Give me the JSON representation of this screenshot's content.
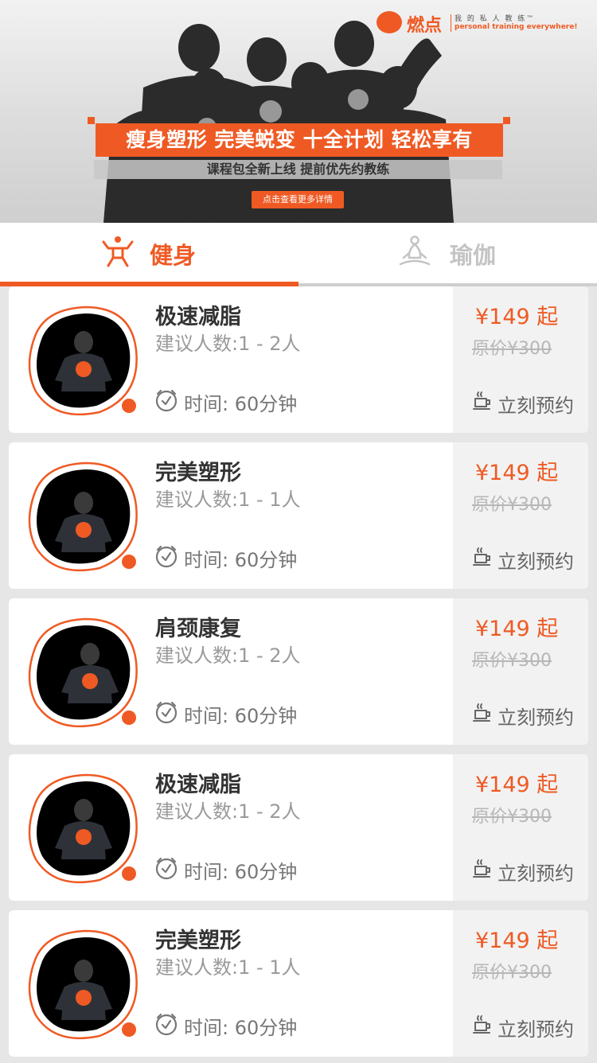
{
  "banner": {
    "brand_name": "燃点",
    "brand_tagline_cn": "我 的 私 人 教 练™",
    "brand_tagline_en": "personal training everywhere!",
    "slogan": "瘦身塑形  完美蜕变  十全计划  轻松享有",
    "sub_slogan": "课程包全新上线   提前优先约教练",
    "detail_button": "点击查看更多详情"
  },
  "tabs": [
    {
      "label": "健身",
      "icon": "fitness-person-icon",
      "active": true
    },
    {
      "label": "瑜伽",
      "icon": "yoga-meditation-icon",
      "active": false
    }
  ],
  "colors": {
    "accent": "#ef5a24",
    "inactive": "#c4c4c4",
    "price_panel": "#f2f2f2"
  },
  "courses": [
    {
      "title": "极速减脂",
      "people": "建议人数:1 - 2人",
      "time": "时间:  60分钟",
      "price": "¥149 起",
      "original_price": "原价¥300",
      "book": "立刻预约"
    },
    {
      "title": "完美塑形",
      "people": "建议人数:1 - 1人",
      "time": "时间:  60分钟",
      "price": "¥149 起",
      "original_price": "原价¥300",
      "book": "立刻预约"
    },
    {
      "title": "肩颈康复",
      "people": "建议人数:1 - 2人",
      "time": "时间:  60分钟",
      "price": "¥149 起",
      "original_price": "原价¥300",
      "book": "立刻预约"
    },
    {
      "title": "极速减脂",
      "people": "建议人数:1 - 2人",
      "time": "时间:  60分钟",
      "price": "¥149 起",
      "original_price": "原价¥300",
      "book": "立刻预约"
    },
    {
      "title": "完美塑形",
      "people": "建议人数:1 - 1人",
      "time": "时间:  60分钟",
      "price": "¥149 起",
      "original_price": "原价¥300",
      "book": "立刻预约"
    }
  ]
}
